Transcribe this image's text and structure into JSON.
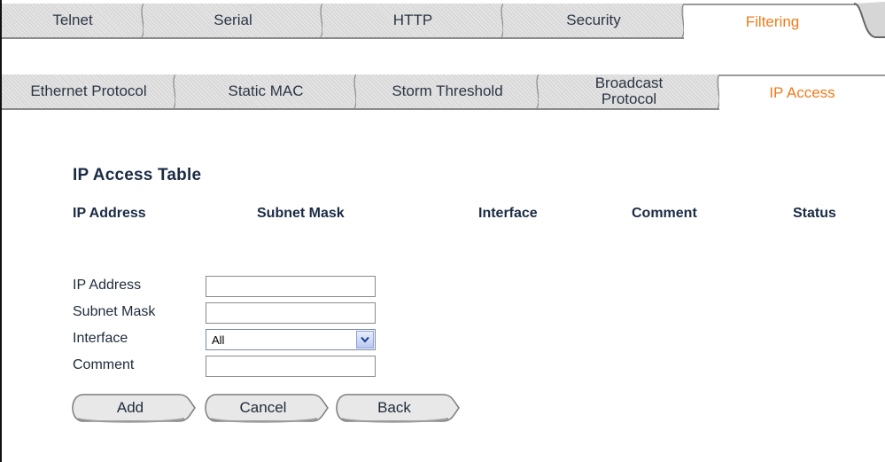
{
  "top_tabs": [
    {
      "label": "Telnet",
      "active": false
    },
    {
      "label": "Serial",
      "active": false
    },
    {
      "label": "HTTP",
      "active": false
    },
    {
      "label": "Security",
      "active": false
    },
    {
      "label": "Filtering",
      "active": true
    }
  ],
  "sub_tabs": [
    {
      "label": "Ethernet Protocol",
      "active": false
    },
    {
      "label": "Static MAC",
      "active": false
    },
    {
      "label": "Storm Threshold",
      "active": false
    },
    {
      "label": "Broadcast Protocol",
      "active": false
    },
    {
      "label": "IP Access",
      "active": true
    }
  ],
  "table": {
    "title": "IP Access Table",
    "columns": [
      "IP Address",
      "Subnet Mask",
      "Interface",
      "Comment",
      "Status"
    ]
  },
  "form": {
    "ip_label": "IP Address",
    "ip_value": "",
    "subnet_label": "Subnet Mask",
    "subnet_value": "",
    "interface_label": "Interface",
    "interface_value": "All",
    "comment_label": "Comment",
    "comment_value": ""
  },
  "buttons": {
    "add": "Add",
    "cancel": "Cancel",
    "back": "Back"
  },
  "colors": {
    "active_tab_text": "#f07a1a",
    "heading_text": "#1b2b44"
  }
}
